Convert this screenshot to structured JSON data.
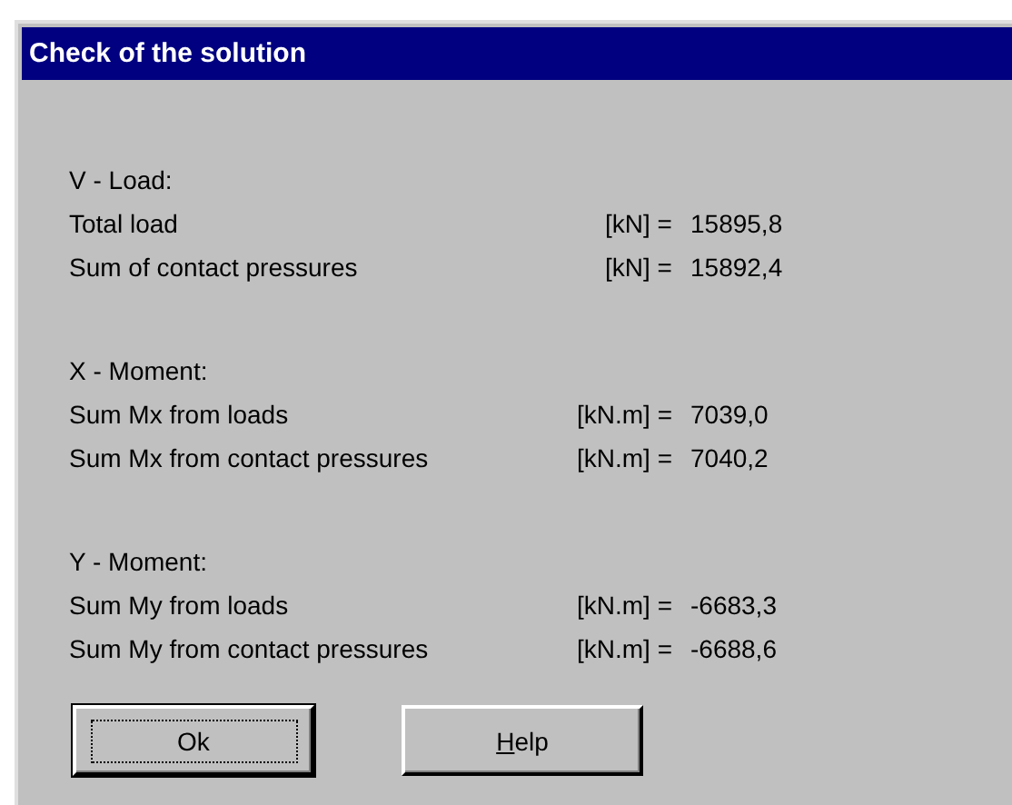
{
  "window": {
    "title": "Check of the solution"
  },
  "sections": [
    {
      "heading": "V - Load:",
      "rows": [
        {
          "label": "Total load",
          "unit": "[kN] =",
          "value": "15895,8"
        },
        {
          "label": "Sum of contact pressures",
          "unit": "[kN] =",
          "value": "15892,4"
        }
      ]
    },
    {
      "heading": "X - Moment:",
      "rows": [
        {
          "label": "Sum Mx from loads",
          "unit": "[kN.m] =",
          "value": "7039,0"
        },
        {
          "label": "Sum Mx from contact pressures",
          "unit": "[kN.m] =",
          "value": "7040,2"
        }
      ]
    },
    {
      "heading": "Y - Moment:",
      "rows": [
        {
          "label": "Sum My from loads",
          "unit": "[kN.m] =",
          "value": "-6683,3"
        },
        {
          "label": "Sum My from contact pressures",
          "unit": "[kN.m] =",
          "value": "-6688,6"
        }
      ]
    }
  ],
  "buttons": [
    {
      "label": "Ok",
      "default": true,
      "focused": true
    },
    {
      "label": "Help",
      "default": false,
      "focused": false,
      "first_letter_underlined": true
    }
  ]
}
